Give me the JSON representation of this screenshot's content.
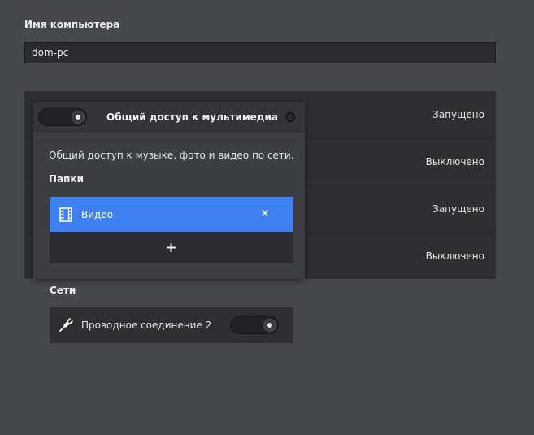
{
  "hostname": {
    "label": "Имя компьютера",
    "value": "dom-pc"
  },
  "services": [
    {
      "status": "Запущено"
    },
    {
      "status": "Выключено"
    },
    {
      "status": "Запущено"
    },
    {
      "status": "Выключено"
    }
  ],
  "popover": {
    "title": "Общий доступ к мультимедиа",
    "toggle_on": true,
    "description": "Общий доступ к музыке, фото и видео по сети.",
    "folders_heading": "Папки",
    "folders": [
      {
        "name": "Видео",
        "icon": "film-icon",
        "remove_label": "✕"
      }
    ],
    "add_label": "+",
    "networks_heading": "Сети",
    "networks": [
      {
        "name": "Проводное соединение 2",
        "icon": "plug-icon",
        "enabled": true
      }
    ]
  },
  "colors": {
    "background": "#46474b",
    "accent": "#3e80f1",
    "panel": "#2f2f31"
  }
}
